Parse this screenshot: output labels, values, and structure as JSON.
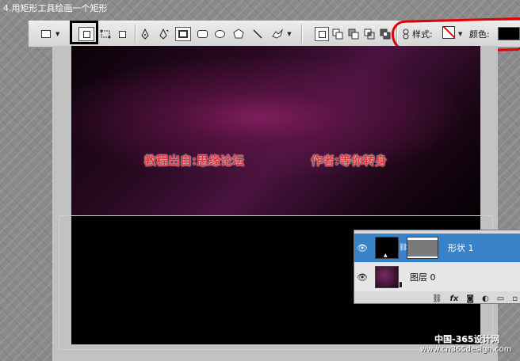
{
  "step_title": "4.用矩形工具绘画一个矩形",
  "toolbar": {
    "style_label": "样式:",
    "color_label": "颜色:",
    "color_value": "#000000",
    "highlight_color": "#e00000"
  },
  "canvas": {
    "text_source": "教程出自:思缘论坛",
    "text_author": "作者:等你转身",
    "text_color": "#e0333a"
  },
  "layers": {
    "items": [
      {
        "name": "形状 1",
        "selected": true
      },
      {
        "name": "图层 0",
        "selected": false
      }
    ],
    "footer_icons": [
      "link-icon",
      "fx-icon",
      "mask-icon",
      "adjustment-icon",
      "folder-icon",
      "new-layer-icon"
    ],
    "selected_color": "#3a82c8"
  },
  "watermark": {
    "site_cn": "中国-365设计网",
    "site_url": "www.cn365design.com"
  }
}
